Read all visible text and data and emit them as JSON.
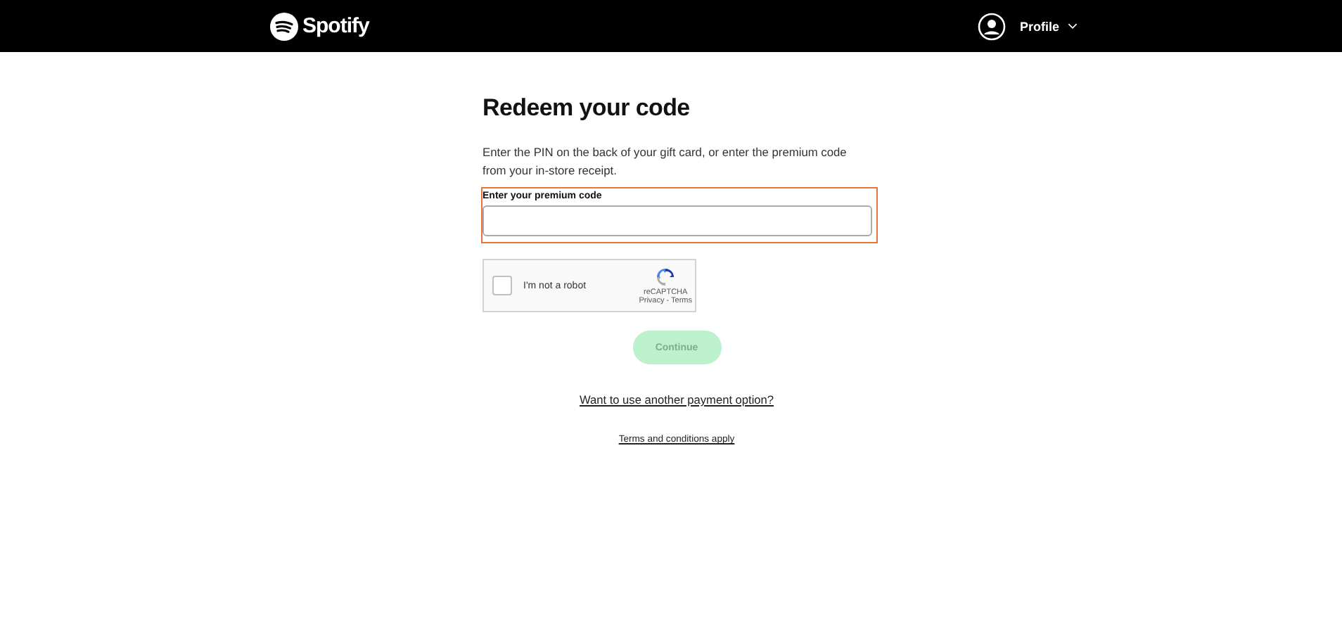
{
  "header": {
    "logo": "Spotify",
    "profile": "Profile"
  },
  "title": "Redeem your code",
  "description": "Enter the PIN on the back of your gift card, or enter the premium code from your in-store receipt.",
  "code_field": {
    "label": "Enter your premium code",
    "highlighted": true
  },
  "captcha": {
    "label": "I'm not a robot",
    "checked": false,
    "brand": "reCAPTCHA",
    "links": "Privacy - Terms"
  },
  "continue_button": {
    "label": "Continue",
    "disabled": true
  },
  "payment_link": "Want to use another payment option?",
  "terms_link": "Terms and conditions apply"
}
